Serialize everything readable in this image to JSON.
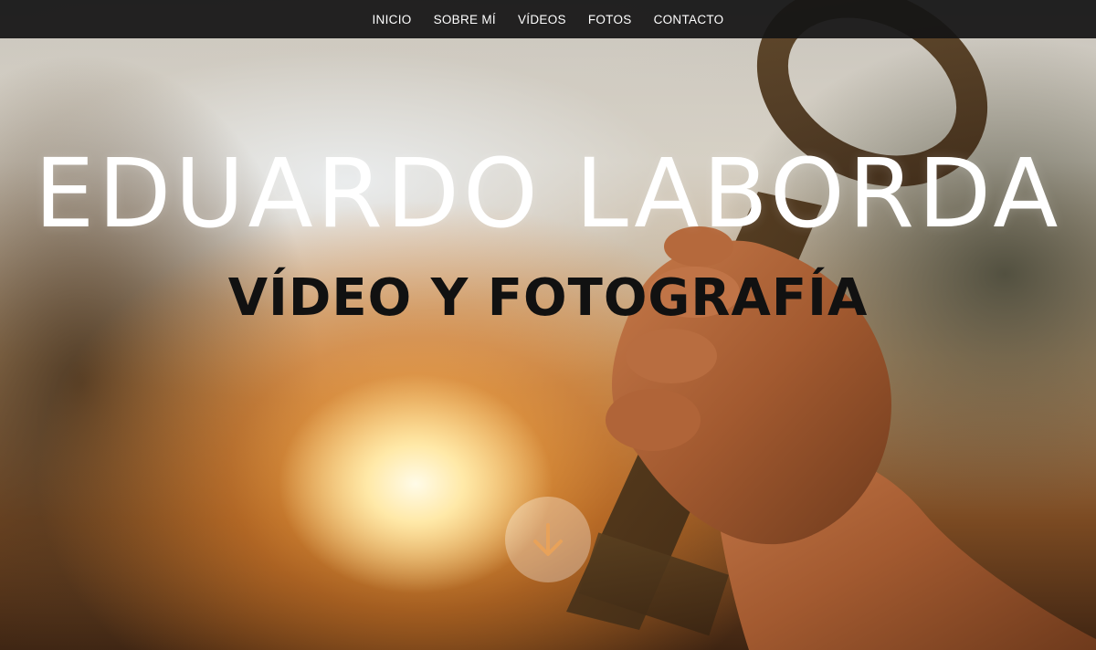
{
  "nav": {
    "items": [
      {
        "label": "INICIO"
      },
      {
        "label": "SOBRE MÍ"
      },
      {
        "label": "VÍDEOS"
      },
      {
        "label": "FOTOS"
      },
      {
        "label": "CONTACTO"
      }
    ]
  },
  "hero": {
    "title": "EDUARDO LABORDA",
    "subtitle": "VÍDEO Y FOTOGRAFÍA",
    "scroll_icon": "arrow-down-icon"
  },
  "colors": {
    "navbar_bg": "#141414",
    "title_text": "#ffffff",
    "subtitle_text": "#111111"
  }
}
